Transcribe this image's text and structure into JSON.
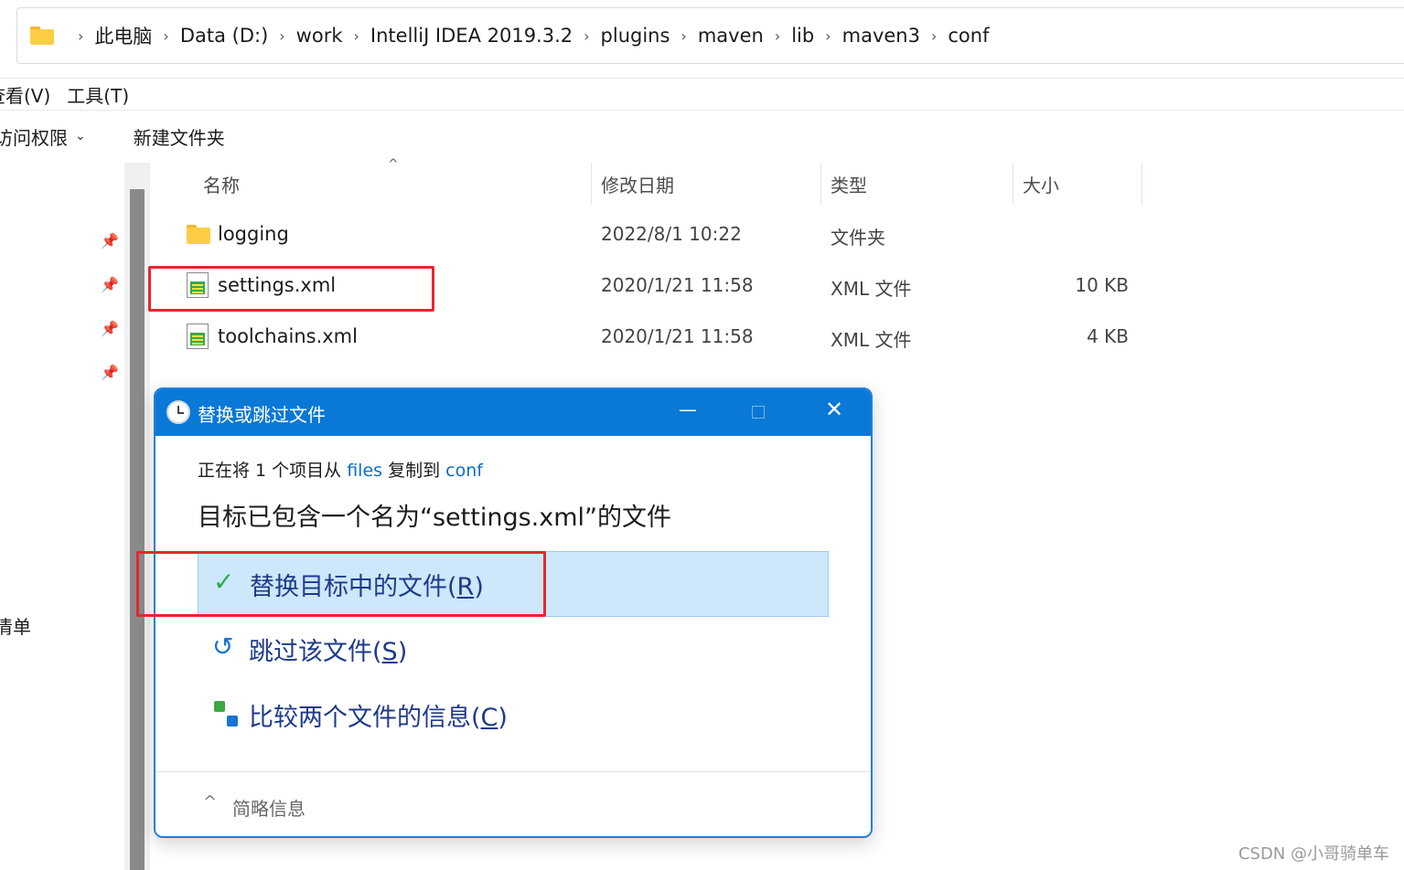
{
  "address_bar": {
    "crumbs": [
      "此电脑",
      "Data (D:)",
      "work",
      "IntelliJ IDEA 2019.3.2",
      "plugins",
      "maven",
      "lib",
      "maven3",
      "conf"
    ],
    "separator": "›"
  },
  "menubar": {
    "view": "查看(V)",
    "tools": "工具(T)"
  },
  "toolbar": {
    "access": "访问权限",
    "new_folder": "新建文件夹"
  },
  "nav": {
    "partial_label": "清单"
  },
  "columns": {
    "name": "名称",
    "modified": "修改日期",
    "type": "类型",
    "size": "大小"
  },
  "files": [
    {
      "name": "logging",
      "modified": "2022/8/1 10:22",
      "type": "文件夹",
      "size": ""
    },
    {
      "name": "settings.xml",
      "modified": "2020/1/21 11:58",
      "type": "XML 文件",
      "size": "10 KB"
    },
    {
      "name": "toolchains.xml",
      "modified": "2020/1/21 11:58",
      "type": "XML 文件",
      "size": "4 KB"
    }
  ],
  "dialog": {
    "title": "替换或跳过文件",
    "copy_prefix": "正在将 1 个项目从 ",
    "source": "files",
    "copy_middle": " 复制到 ",
    "destination": "conf",
    "message": "目标已包含一个名为“settings.xml”的文件",
    "options": {
      "replace_text": "替换目标中的文件(",
      "replace_key": "R",
      "skip_text": "跳过该文件(",
      "skip_key": "S",
      "compare_text": "比较两个文件的信息(",
      "compare_key": "C",
      "close_paren": ")"
    },
    "footer": "简略信息"
  },
  "watermark": "CSDN @小哥骑单车",
  "colors": {
    "accent": "#0a78d6",
    "highlight": "#cde7fb",
    "annotation": "#e8262b"
  }
}
